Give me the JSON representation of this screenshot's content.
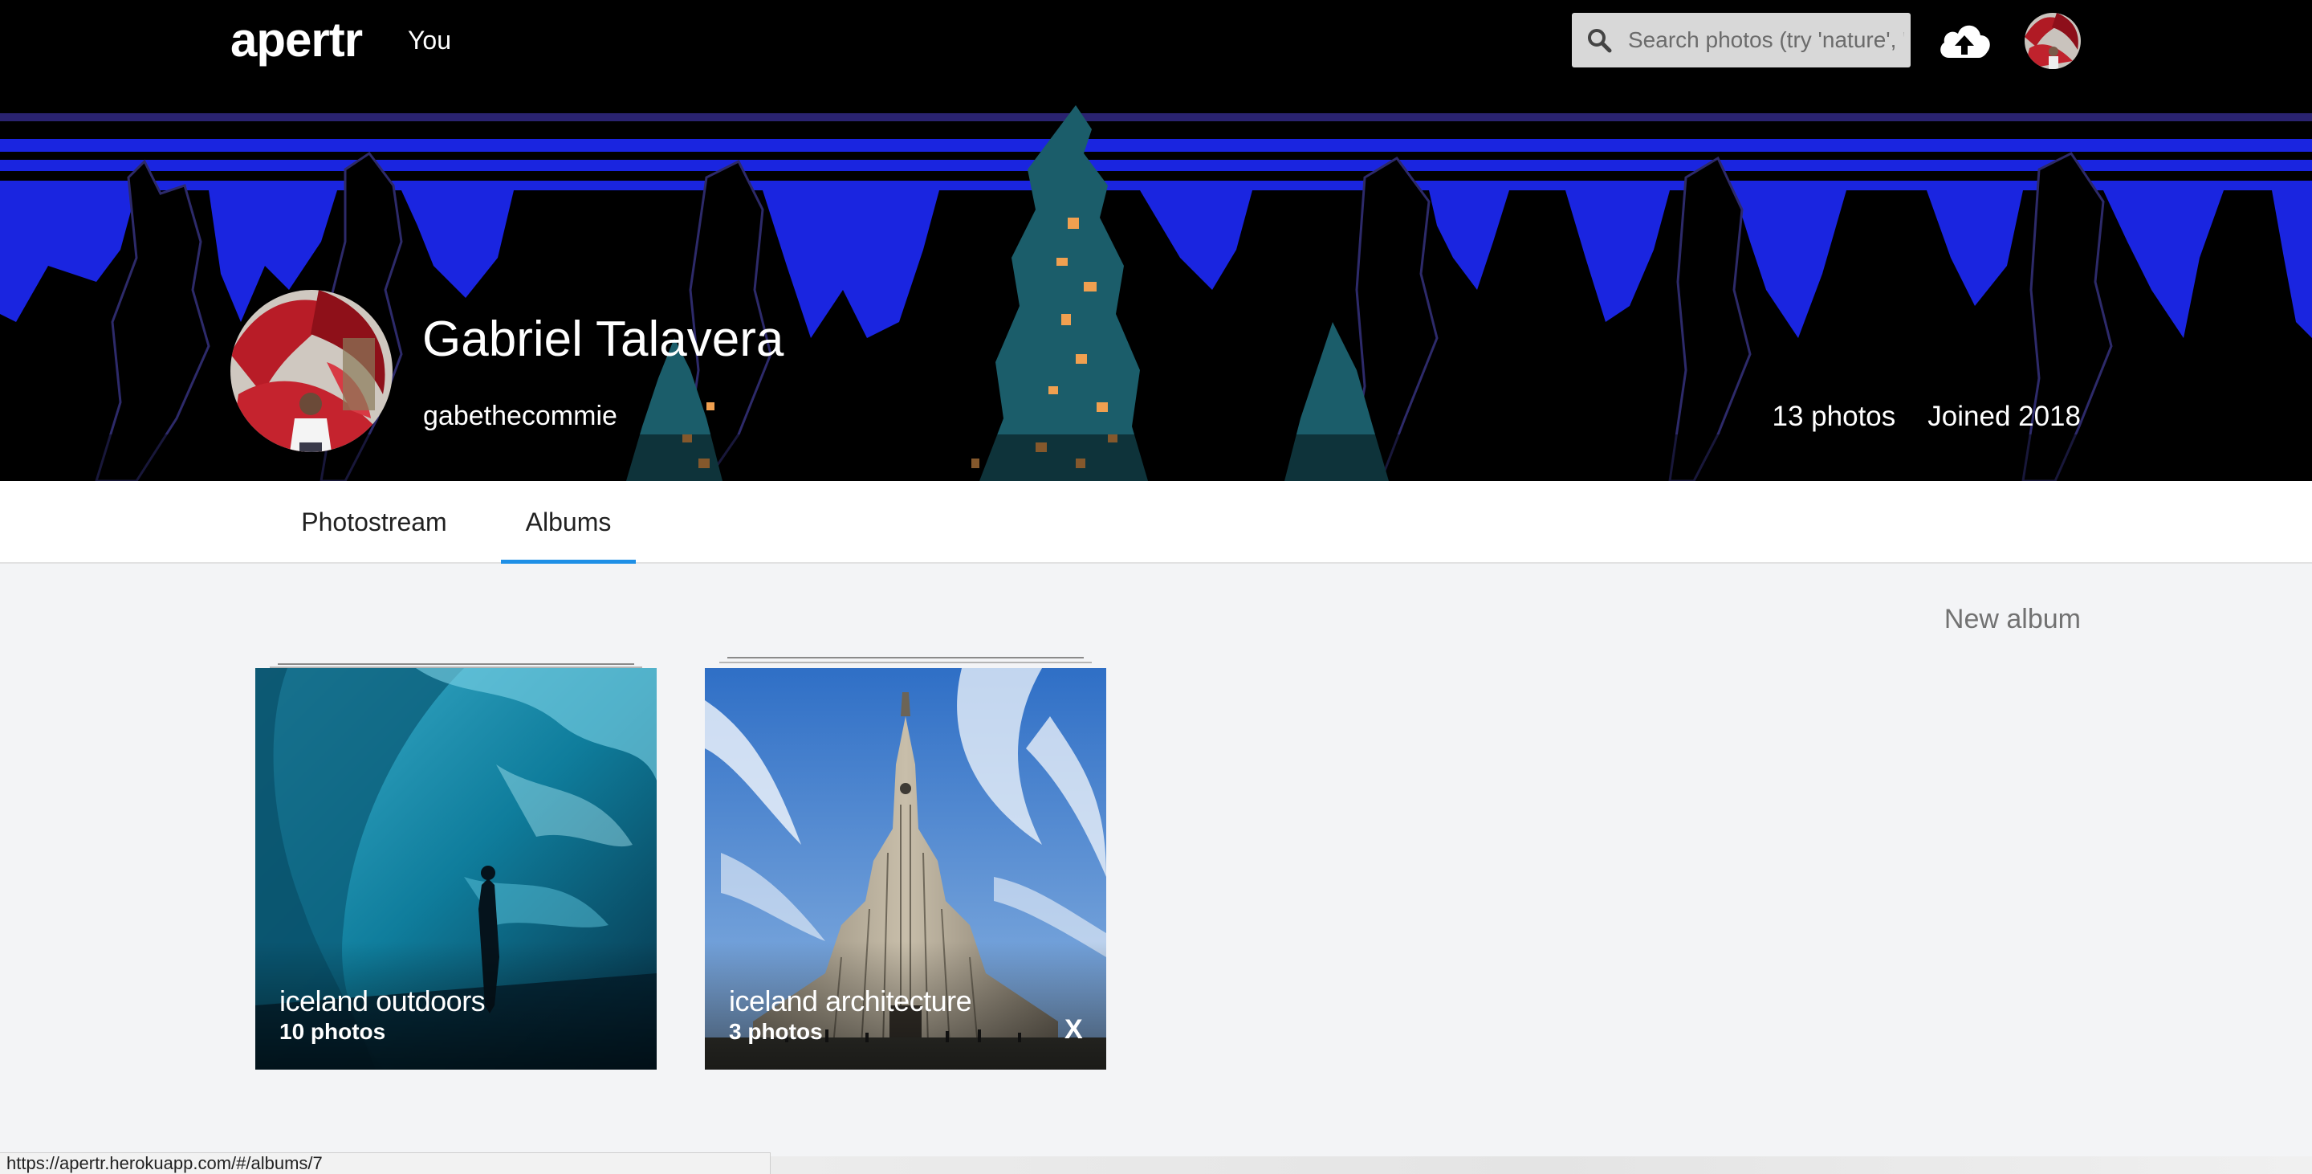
{
  "nav": {
    "logo": "apertr",
    "you_link": "You",
    "search_placeholder": "Search photos (try 'nature', 'iceland')",
    "upload_icon": "cloud-upload-icon",
    "avatar_icon": "user-avatar"
  },
  "profile": {
    "name": "Gabriel Talavera",
    "username": "gabethecommie",
    "photo_count": "13 photos",
    "joined": "Joined 2018"
  },
  "tabs": [
    {
      "label": "Photostream",
      "active": false
    },
    {
      "label": "Albums",
      "active": true
    }
  ],
  "albums_page": {
    "new_album_label": "New album",
    "albums": [
      {
        "title": "iceland outdoors",
        "count": "10 photos"
      },
      {
        "title": "iceland architecture",
        "count": "3 photos",
        "delete_label": "X"
      }
    ]
  },
  "status_bar": {
    "url": "https://apertr.herokuapp.com/#/albums/7"
  },
  "colors": {
    "nav_bg": "#000000",
    "tab_accent": "#1e8fe6",
    "page_bg": "#f3f4f6",
    "banner_blue": "#1a25e0",
    "banner_orange": "#f0a050"
  }
}
